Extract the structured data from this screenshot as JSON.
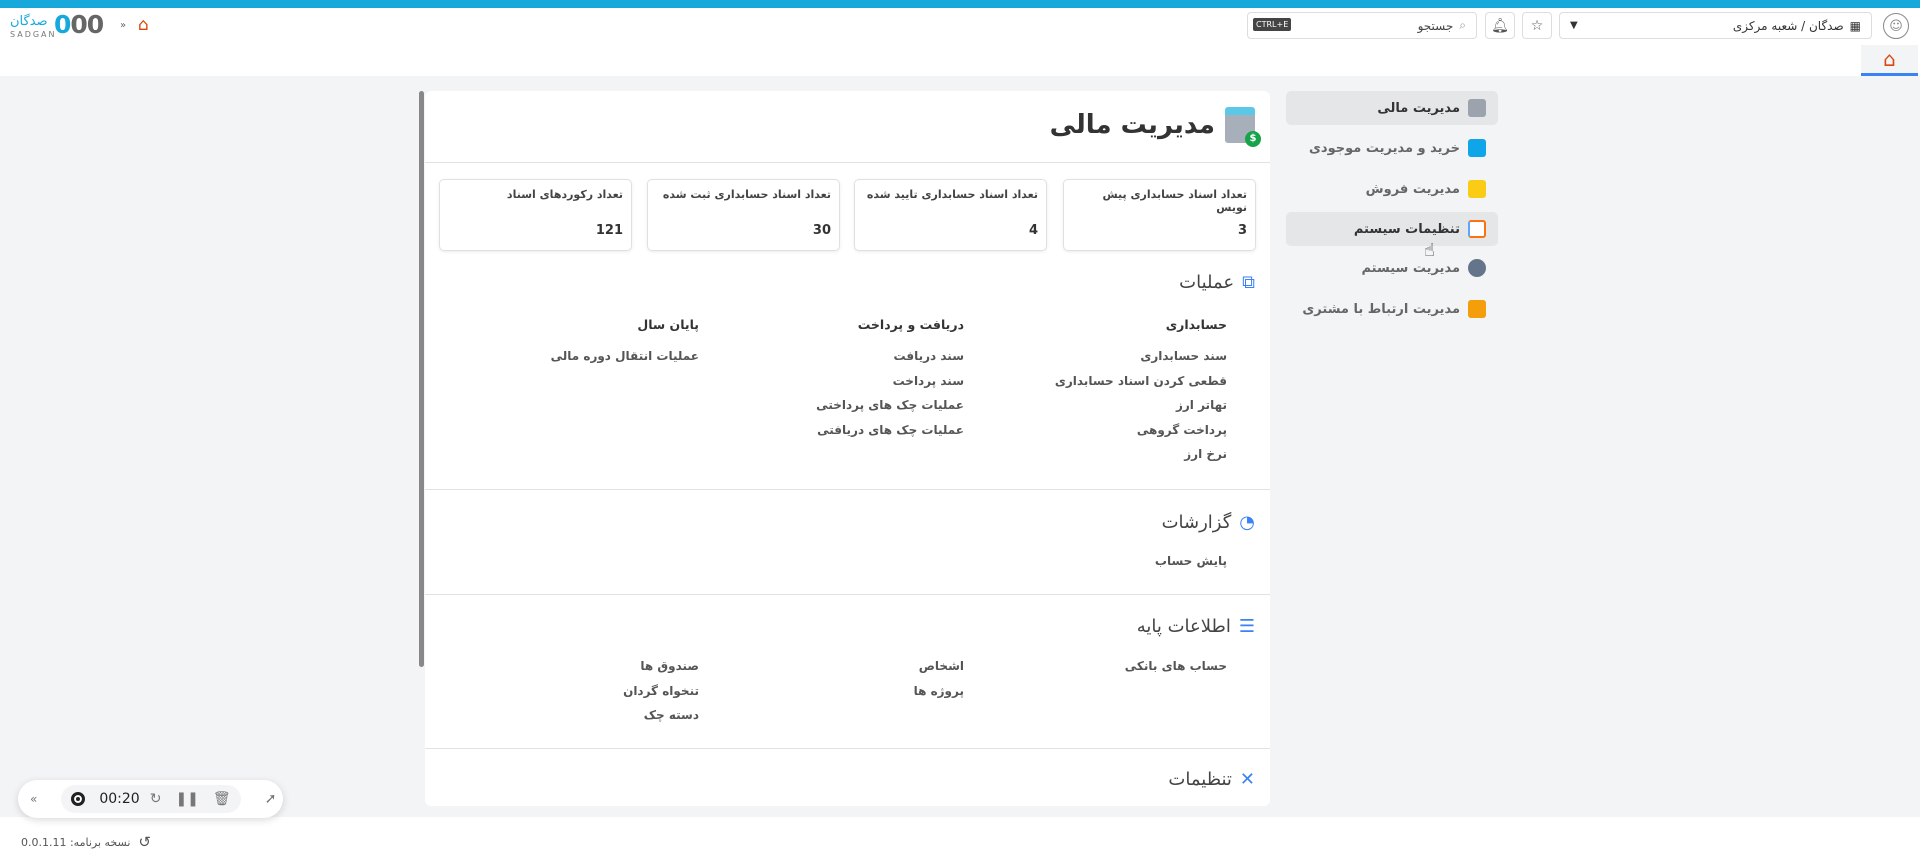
{
  "header": {
    "logo_fa": "صدگان",
    "logo_en": "SADGAN",
    "logo_num": "000",
    "collapse": "»",
    "search_placeholder": "جستجو",
    "search_shortcut": "CTRL+E",
    "branch": "صدگان / شعبه مرکزی"
  },
  "page": {
    "title": "مدیریت مالی"
  },
  "cards": [
    {
      "label": "تعداد اسناد حسابداری پیش نویس",
      "value": "3"
    },
    {
      "label": "تعداد اسناد حسابداری تایید شده",
      "value": "4"
    },
    {
      "label": "تعداد اسناد حسابداری ثبت شده",
      "value": "30"
    },
    {
      "label": "تعداد رکوردهای اسناد",
      "value": "121"
    }
  ],
  "sections": {
    "operations": {
      "title": "عملیات",
      "columns": [
        {
          "heading": "حسابداری",
          "items": [
            "سند حسابداری",
            "قطعی کردن اسناد حسابداری",
            "تهاتر ارز",
            "پرداخت گروهی",
            "نرخ ارز"
          ]
        },
        {
          "heading": "دریافت و پرداخت",
          "items": [
            "سند دریافت",
            "سند پرداخت",
            "عملیات چک های پرداختی",
            "عملیات چک های دریافتی"
          ]
        },
        {
          "heading": "پایان سال",
          "items": [
            "عملیات انتقال دوره مالی"
          ]
        }
      ]
    },
    "reports": {
      "title": "گزارشات",
      "items": [
        "پایش حساب"
      ]
    },
    "base": {
      "title": "اطلاعات پایه",
      "columns": [
        [
          "حساب های بانکی"
        ],
        [
          "اشخاص",
          "پروژه ها"
        ],
        [
          "صندوق ها",
          "تنخواه گردان",
          "دسته چک"
        ]
      ]
    },
    "settings": {
      "title": "تنظیمات"
    }
  },
  "sidebar": [
    {
      "label": "مدیریت مالی",
      "color": "#9ca3af"
    },
    {
      "label": "خرید و مدیریت موجودی",
      "color": "#0ea5e9"
    },
    {
      "label": "مدیریت فروش",
      "color": "#facc15"
    },
    {
      "label": "تنظیمات سیستم",
      "color": "#60a5fa"
    },
    {
      "label": "مدیریت سیستم",
      "color": "#64748b"
    },
    {
      "label": "مدیریت ارتباط با مشتری",
      "color": "#f59e0b"
    }
  ],
  "footer": {
    "version": "نسخه برنامه: 0.0.1.11"
  },
  "recorder": {
    "time": "00:20"
  }
}
